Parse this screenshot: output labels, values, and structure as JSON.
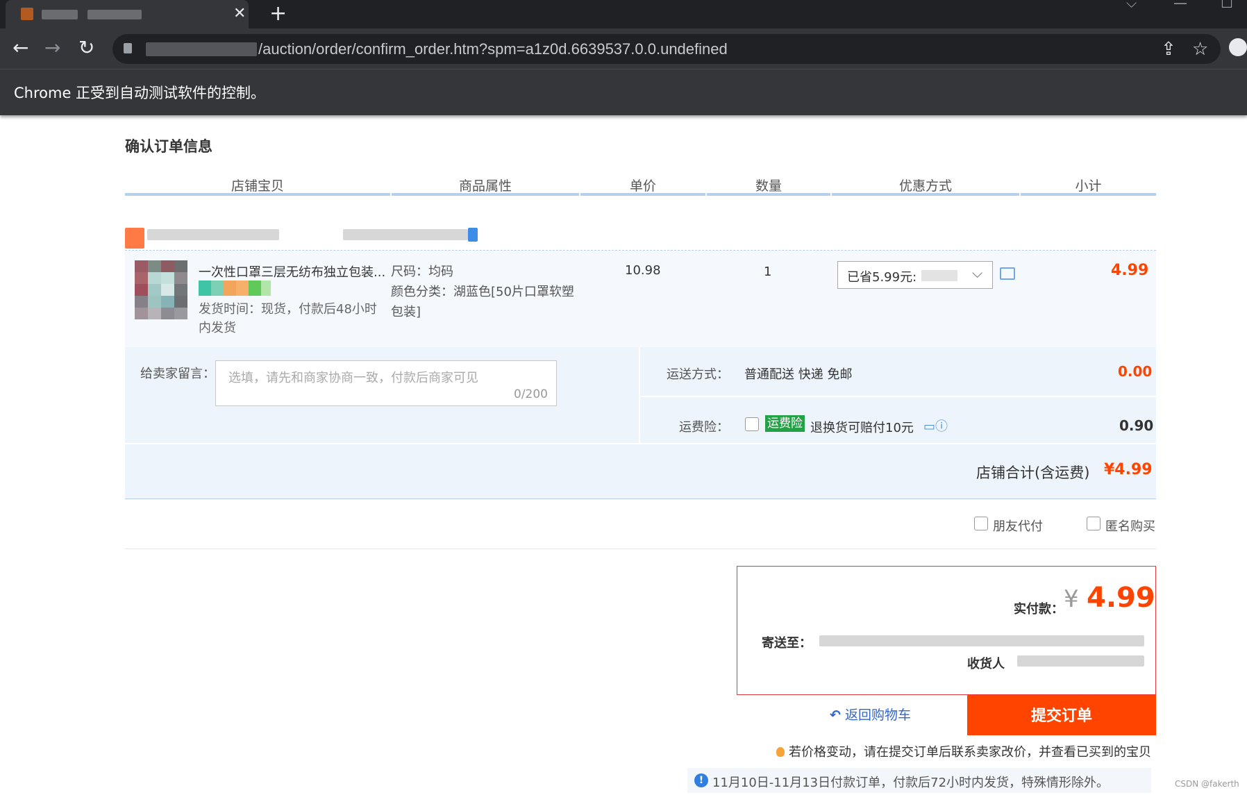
{
  "browser": {
    "url_visible": "/auction/order/confirm_order.htm?spm=a1z0d.6639537.0.0.undefined",
    "tab_close": "✕",
    "new_tab": "+",
    "automation_notice": "Chrome 正受到自动测试软件的控制。"
  },
  "page": {
    "title": "确认订单信息",
    "columns": [
      "店铺宝贝",
      "商品属性",
      "单价",
      "数量",
      "优惠方式",
      "小计"
    ]
  },
  "item": {
    "title": "一次性口罩三层无纺布独立包装...",
    "ship_time": "发货时间：现货，付款后48小时内发货",
    "attr_size": "尺码：均码",
    "attr_color": "颜色分类：湖蓝色[50片口罩软塑包装]",
    "unit_price": "10.98",
    "quantity": "1",
    "discount": "已省5.99元:",
    "subtotal": "4.99"
  },
  "details": {
    "memo_label": "给卖家留言：",
    "memo_placeholder": "选填，请先和商家协商一致，付款后商家可见",
    "memo_count": "0/200",
    "shipping_label": "运送方式：",
    "shipping_value": "普通配送 快递 免邮",
    "shipping_fee": "0.00",
    "insurance_label": "运费险：",
    "insurance_badge": "运费险",
    "insurance_desc": "退换货可赔付10元",
    "insurance_fee": "0.90",
    "shop_total_label": "店铺合计(含运费)",
    "shop_total_value": "¥4.99"
  },
  "options": {
    "friend_pay": "朋友代付",
    "anonymous": "匿名购买"
  },
  "payment": {
    "label": "实付款：",
    "currency": "¥",
    "amount": "4.99",
    "address_label": "寄送至：",
    "receiver_label": "收货人"
  },
  "actions": {
    "back_arrow": "↶",
    "back_to_cart": "返回购物车",
    "submit": "提交订单"
  },
  "notices": {
    "price_tip": "若价格变动，请在提交订单后联系卖家改价，并查看已买到的宝贝",
    "info_glyph": "!",
    "ship_notice": "11月10日-11月13日付款订单，付款后72小时内发货，特殊情形除外。"
  },
  "watermark": "CSDN @fakerth",
  "colors": {
    "accent_orange": "#ff4400",
    "link_blue": "#3366cc",
    "insurance_green": "#24a046",
    "pay_box_border": "#e4393c"
  }
}
